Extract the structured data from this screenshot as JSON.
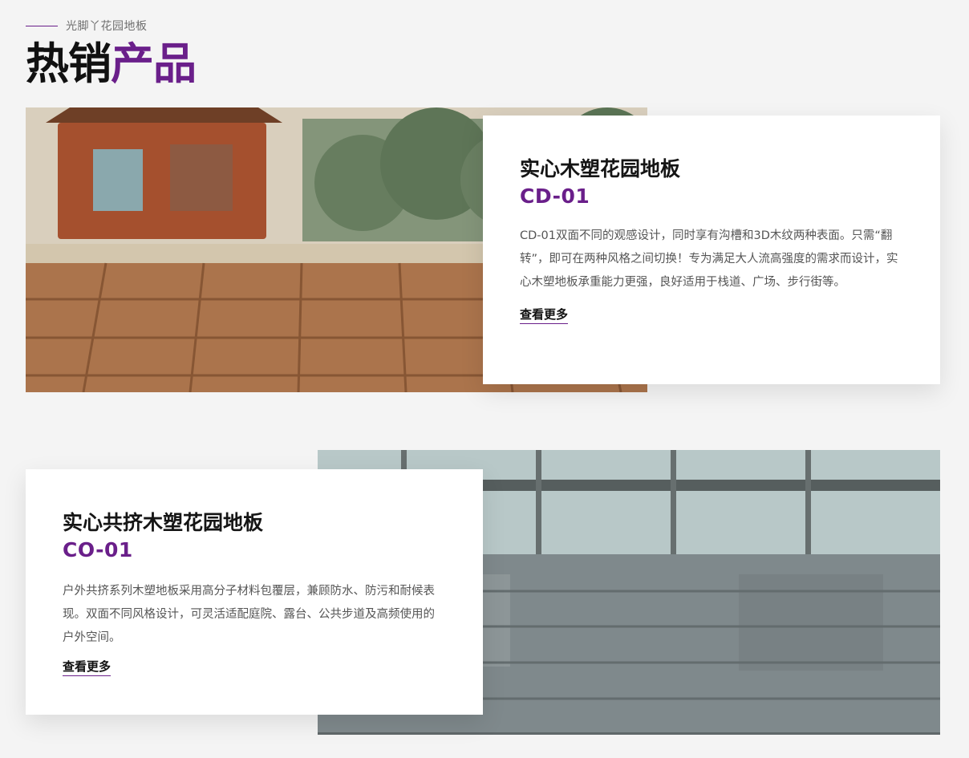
{
  "section": {
    "eyebrow": "光脚丫花园地板",
    "title_main": "热销",
    "title_accent": "产品"
  },
  "products": [
    {
      "title": "实心木塑花园地板",
      "code": "CD-01",
      "description": "CD-01双面不同的观感设计，同时享有沟槽和3D木纹两种表面。只需“翻转”，即可在两种风格之间切换！专为满足大人流高强度的需求而设计，实心木塑地板承重能力更强，良好适用于栈道、广场、步行街等。",
      "link": "查看更多"
    },
    {
      "title": "实心共挤木塑花园地板",
      "code": "CO-01",
      "description": "户外共挤系列木塑地板采用高分子材料包覆层，兼顾防水、防污和耐候表现。双面不同风格设计，可灵活适配庭院、露台、公共步道及高频使用的户外空间。",
      "link": "查看更多"
    }
  ],
  "colors": {
    "accent": "#6a1f8a",
    "background": "#f4f4f4"
  }
}
